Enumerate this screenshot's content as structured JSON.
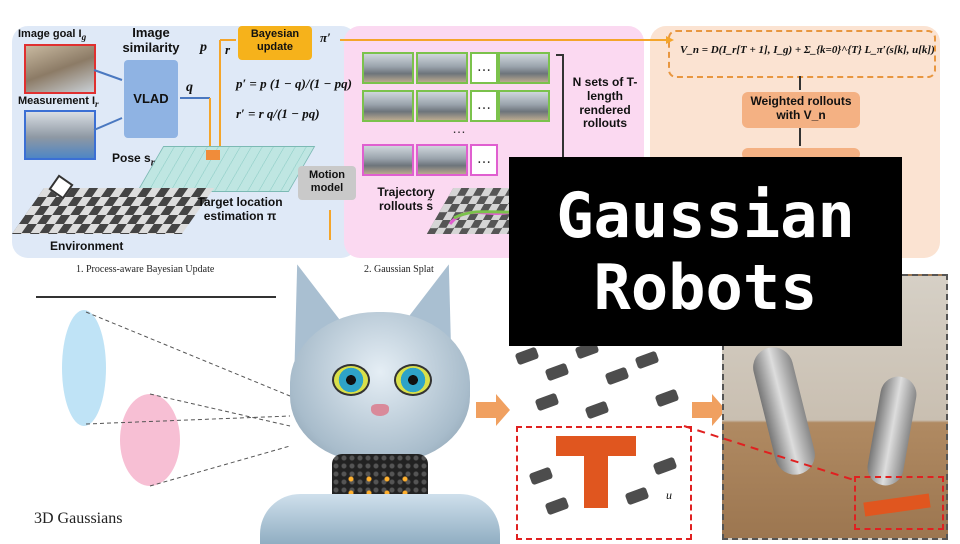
{
  "title": {
    "line1": "Gaussian",
    "line2": "Robots"
  },
  "diagram": {
    "image_goal": "Image goal I",
    "image_goal_sub": "g",
    "measurement": "Measurement I",
    "measurement_sub": "r",
    "image_similarity": "Image similarity",
    "vlad": "VLAD",
    "q": "q",
    "p": "p",
    "r": "r",
    "bayesian_update": "Bayesian update",
    "pi_prime": "π′",
    "eq1": "p′ = p (1 − q)/(1 − pq)",
    "eq2": "r′ = r q/(1 − pq)",
    "pose": "Pose s",
    "pose_sub": "r",
    "target_location": "Target location estimation π",
    "environment": "Environment",
    "motion_model": "Motion model",
    "trajectory_rollouts": "Trajectory rollouts s̃",
    "n_sets": "N sets of T-length rendered rollouts",
    "vn_equation": "V_n = D(I_r[T + 1], I_g) + Σ_{k=0}^{T} L_π′(s[k], u[k])",
    "weighted_rollouts": "Weighted rollouts with V_n",
    "caption1": "1. Process-aware Bayesian Update",
    "caption2": "2. Gaussian Splat",
    "ellipsis": "…"
  },
  "lower": {
    "gaussians_label": "3D Gaussians",
    "u_label": "u"
  },
  "colors": {
    "title_bg": "#000000",
    "title_fg": "#ffffff",
    "panel_blue": "#dfe9f7",
    "panel_pink": "#fbd9f1",
    "panel_peach": "#fbe3d2",
    "accent_orange": "#f4a52a",
    "t_block": "#e0561f"
  }
}
